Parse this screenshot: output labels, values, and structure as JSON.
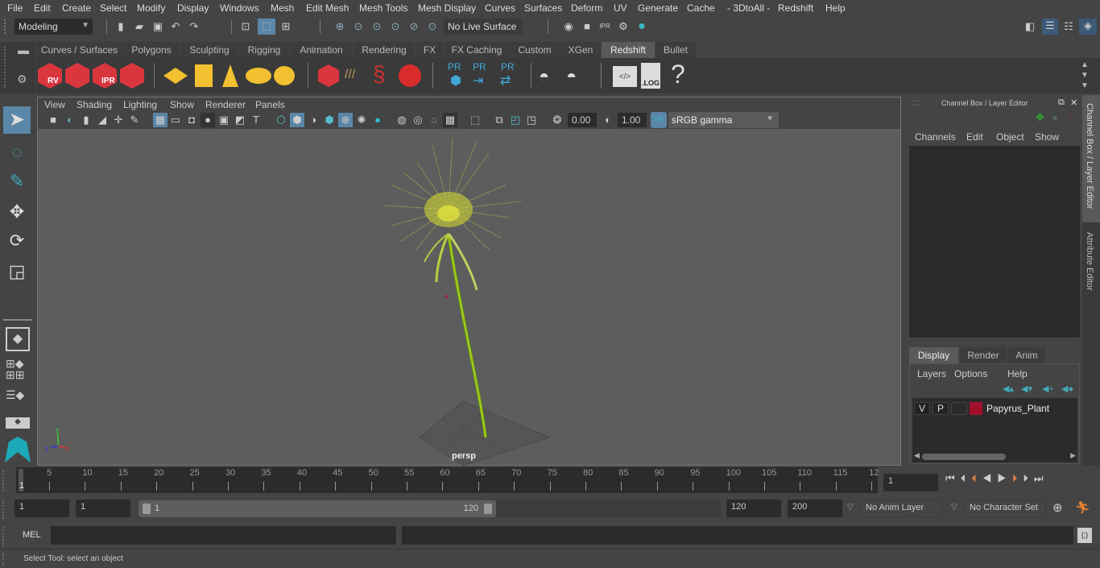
{
  "menubar": [
    "File",
    "Edit",
    "Create",
    "Select",
    "Modify",
    "Display",
    "Windows",
    "Mesh",
    "Edit Mesh",
    "Mesh Tools",
    "Mesh Display",
    "Curves",
    "Surfaces",
    "Deform",
    "UV",
    "Generate",
    "Cache",
    "- 3DtoAll -",
    "Redshift",
    "Help"
  ],
  "toolbar": {
    "mode": "Modeling",
    "live_surface": "No Live Surface"
  },
  "shelf": {
    "tabs": [
      "Curves / Surfaces",
      "Polygons",
      "Sculpting",
      "Rigging",
      "Animation",
      "Rendering",
      "FX",
      "FX Caching",
      "Custom",
      "XGen",
      "Redshift",
      "Bullet"
    ],
    "active_tab": "Redshift",
    "icons": [
      {
        "name": "rs-render-view",
        "label": "RV"
      },
      {
        "name": "rs-batch-render",
        "label": ""
      },
      {
        "name": "rs-ipr",
        "label": "IPR"
      },
      {
        "name": "rs-render-settings",
        "label": ""
      },
      {
        "name": "rs-area-light",
        "label": ""
      },
      {
        "name": "rs-portal-light",
        "label": ""
      },
      {
        "name": "rs-spot-light",
        "label": ""
      },
      {
        "name": "rs-dome-light",
        "label": ""
      },
      {
        "name": "rs-sun-sky",
        "label": ""
      },
      {
        "name": "rs-volume",
        "label": ""
      },
      {
        "name": "rs-hair",
        "label": ""
      },
      {
        "name": "rs-mesh-light",
        "label": ""
      },
      {
        "name": "rs-material",
        "label": ""
      },
      {
        "name": "rs-proxy-export",
        "label": "PR"
      },
      {
        "name": "rs-proxy-import",
        "label": "PR"
      },
      {
        "name": "rs-proxy-swap",
        "label": "PR"
      },
      {
        "name": "rs-bake-multi",
        "label": ""
      },
      {
        "name": "rs-bake",
        "label": ""
      },
      {
        "name": "rs-script",
        "label": ""
      },
      {
        "name": "rs-log",
        "label": ".LOG"
      },
      {
        "name": "rs-help",
        "label": "?"
      }
    ]
  },
  "viewport": {
    "menu": [
      "View",
      "Shading",
      "Lighting",
      "Show",
      "Renderer",
      "Panels"
    ],
    "exposure": "0.00",
    "gamma": "1.00",
    "color_space": "sRGB gamma",
    "camera_label": "persp",
    "axis": {
      "x": "x",
      "y": "y",
      "z": "z"
    }
  },
  "channel_box": {
    "title": "Channel Box / Layer Editor",
    "menu": [
      "Channels",
      "Edit",
      "Object",
      "Show"
    ]
  },
  "layer_editor": {
    "tabs": [
      "Display",
      "Render",
      "Anim"
    ],
    "active_tab": "Display",
    "menu": [
      "Layers",
      "Options",
      "Help"
    ],
    "layers": [
      {
        "v": "V",
        "p": "P",
        "color": "#a0102c",
        "name": "Papyrus_Plant"
      }
    ]
  },
  "side_tabs": [
    "Channel Box / Layer Editor",
    "Attribute Editor"
  ],
  "timeline": {
    "ticks": [
      "5",
      "10",
      "15",
      "20",
      "25",
      "30",
      "35",
      "40",
      "45",
      "50",
      "55",
      "60",
      "65",
      "70",
      "75",
      "80",
      "85",
      "90",
      "95",
      "100",
      "105",
      "110",
      "115",
      "12"
    ],
    "current_marker": "1",
    "current_frame": "1"
  },
  "range": {
    "start": "1",
    "playback_start": "1",
    "slider_start": "1",
    "slider_end": "120",
    "playback_end": "120",
    "end": "200",
    "anim_layer": "No Anim Layer",
    "character_set": "No Character Set"
  },
  "command": {
    "lang": "MEL"
  },
  "status": {
    "help_line": "Select Tool: select an object"
  }
}
